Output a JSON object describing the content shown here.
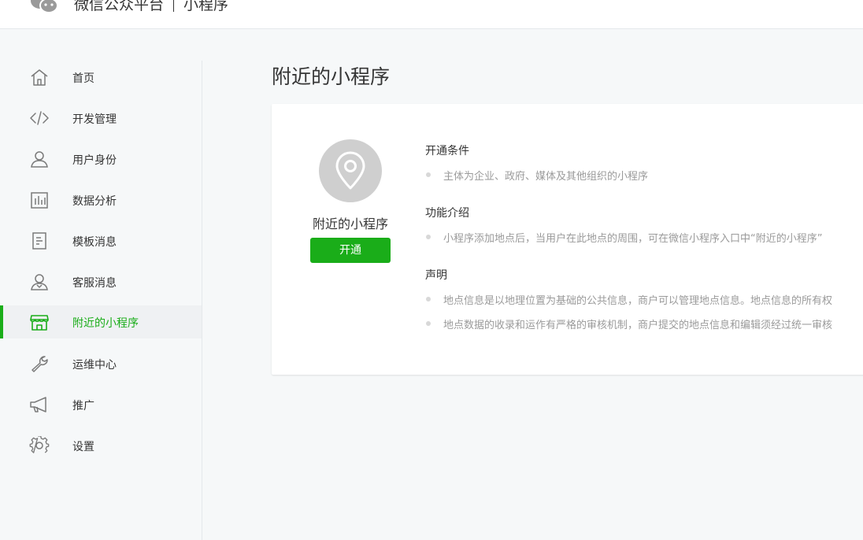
{
  "header": {
    "brand": "微信公众平台",
    "product": "小程序"
  },
  "sidebar": {
    "items": [
      {
        "label": "首页",
        "icon": "home-icon",
        "active": false
      },
      {
        "label": "开发管理",
        "icon": "code-icon",
        "active": false
      },
      {
        "label": "用户身份",
        "icon": "user-icon",
        "active": false
      },
      {
        "label": "数据分析",
        "icon": "chart-icon",
        "active": false
      },
      {
        "label": "模板消息",
        "icon": "document-icon",
        "active": false
      },
      {
        "label": "客服消息",
        "icon": "customer-service-icon",
        "active": false
      },
      {
        "label": "附近的小程序",
        "icon": "store-icon",
        "active": true
      },
      {
        "label": "运维中心",
        "icon": "wrench-icon",
        "active": false
      },
      {
        "label": "推广",
        "icon": "megaphone-icon",
        "active": false
      },
      {
        "label": "设置",
        "icon": "gear-icon",
        "active": false
      }
    ]
  },
  "main": {
    "title": "附近的小程序",
    "card": {
      "feature_name": "附近的小程序",
      "open_button": "开通",
      "sections": [
        {
          "title": "开通条件",
          "bullets": [
            "主体为企业、政府、媒体及其他组织的小程序"
          ]
        },
        {
          "title": "功能介绍",
          "bullets": [
            "小程序添加地点后，当用户在此地点的周围，可在微信小程序入口中“附近的小程序”"
          ]
        },
        {
          "title": "声明",
          "bullets": [
            "地点信息是以地理位置为基础的公共信息，商户可以管理地点信息。地点信息的所有权",
            "地点数据的收录和运作有严格的审核机制，商户提交的地点信息和编辑须经过统一审核"
          ]
        }
      ]
    }
  },
  "colors": {
    "accent": "#1aad19",
    "sidebar_active_bg": "#eff1f3",
    "page_bg": "#f6f8f9",
    "muted_text": "#9a9a9a"
  }
}
